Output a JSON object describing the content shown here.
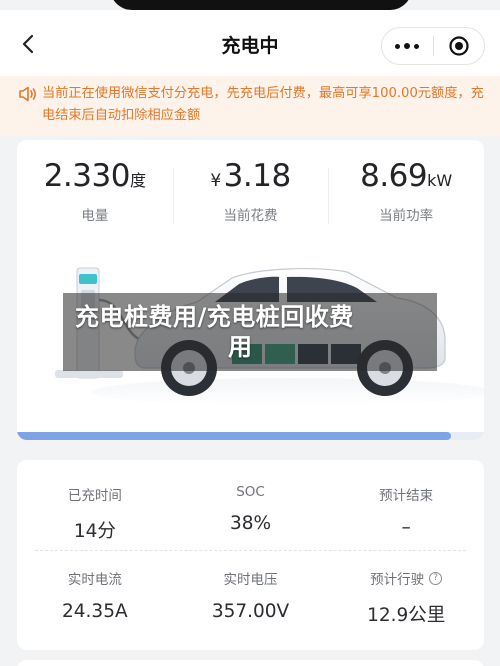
{
  "header": {
    "title": "充电中",
    "back_icon": "chevron-left-icon",
    "more_icon": "more-dots-icon",
    "close_icon": "target-circle-icon"
  },
  "notice": {
    "icon": "speaker-icon",
    "text": "当前正在使用微信支付分充电，先充电后付费，最高可享100.00元额度，充电结束后自动扣除相应金额",
    "color": "#e3782b"
  },
  "summary": {
    "energy": {
      "value": "2.330",
      "unit": "度",
      "label": "电量"
    },
    "cost": {
      "currency": "¥",
      "value": "3.18",
      "label": "当前花费"
    },
    "power": {
      "value": "8.69",
      "unit": "kW",
      "label": "当前功率"
    }
  },
  "overlay": {
    "line1": "充电桩费用/充电桩回收费",
    "line2": "用"
  },
  "progress": {
    "fraction": 0.93,
    "color": "#7fa4e6"
  },
  "details": {
    "row1": [
      {
        "label": "已充时间",
        "value": "14分"
      },
      {
        "label": "SOC",
        "value": "38%"
      },
      {
        "label": "预计结束",
        "value": "–"
      }
    ],
    "row2": [
      {
        "label": "实时电流",
        "value": "24.35A"
      },
      {
        "label": "实时电压",
        "value": "357.00V"
      },
      {
        "label": "预计行驶",
        "value": "12.9公里",
        "help_icon": "question-circle-icon"
      }
    ]
  }
}
